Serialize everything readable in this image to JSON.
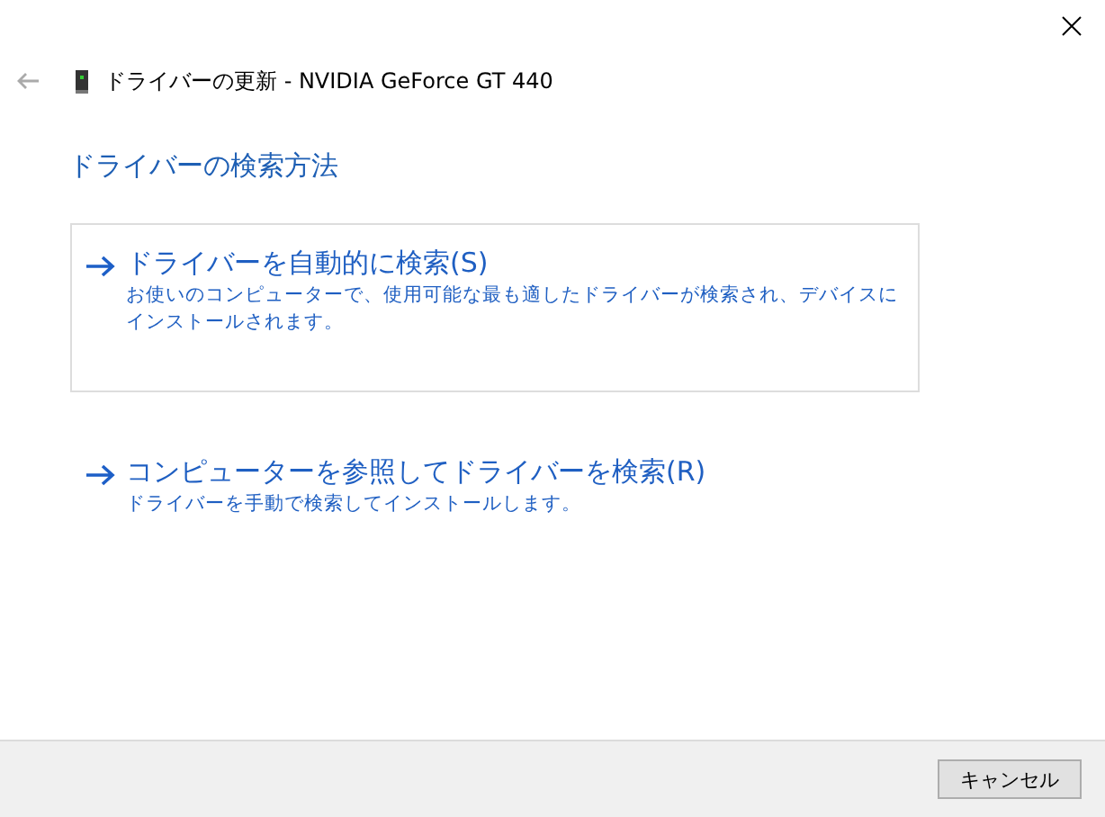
{
  "window": {
    "title": "ドライバーの更新 - NVIDIA GeForce GT 440"
  },
  "heading": "ドライバーの検索方法",
  "options": [
    {
      "title": "ドライバーを自動的に検索(S)",
      "description": "お使いのコンピューターで、使用可能な最も適したドライバーが検索され、デバイスにインストールされます。",
      "focused": true
    },
    {
      "title": "コンピューターを参照してドライバーを検索(R)",
      "description": "ドライバーを手動で検索してインストールします。",
      "focused": false
    }
  ],
  "buttons": [
    {
      "label": "キャンセル"
    }
  ]
}
